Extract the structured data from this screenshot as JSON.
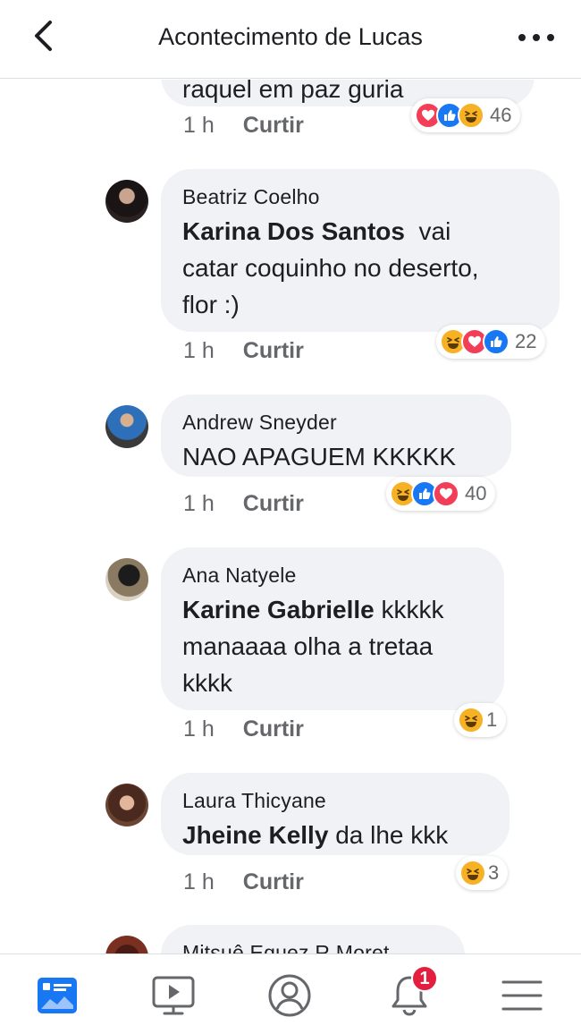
{
  "header": {
    "title": "Acontecimento de Lucas"
  },
  "actions": {
    "time": "1 h",
    "like": "Curtir"
  },
  "top_partial": {
    "text": "raquel em paz guria",
    "reaction_count": "46"
  },
  "comments": [
    {
      "author": "Beatriz Coelho",
      "mention": "Karina Dos Santos",
      "text_lines": [
        "vai",
        "catar coquinho no deserto,",
        "flor :)"
      ],
      "reaction_count": "22"
    },
    {
      "author": "Andrew Sneyder",
      "mention": "",
      "text_lines": [
        "NAO APAGUEM KKKKK"
      ],
      "reaction_count": "40"
    },
    {
      "author": "Ana Natyele",
      "mention": "Karine Gabrielle",
      "text_lines": [
        "kkkkk",
        "manaaaa olha a tretaa",
        "kkkk"
      ],
      "reaction_count": "1"
    },
    {
      "author": "Laura Thicyane",
      "mention": "Jheine Kelly",
      "text_lines": [
        "da lhe kkk"
      ],
      "reaction_count": "3"
    }
  ],
  "bottom_partial": {
    "author": "Mitsuê Equez R Moret"
  },
  "nav": {
    "notifications_badge": "1"
  },
  "colors": {
    "heart": "#f33e58",
    "like": "#1877f2",
    "haha": "#f7b125",
    "bubble": "#f0f2f5",
    "nav_active": "#1877f2"
  },
  "icons": [
    "back-icon",
    "more-icon",
    "news-feed-icon",
    "video-icon",
    "profile-icon",
    "notifications-icon",
    "menu-icon",
    "heart-reaction-icon",
    "like-reaction-icon",
    "haha-reaction-icon"
  ]
}
